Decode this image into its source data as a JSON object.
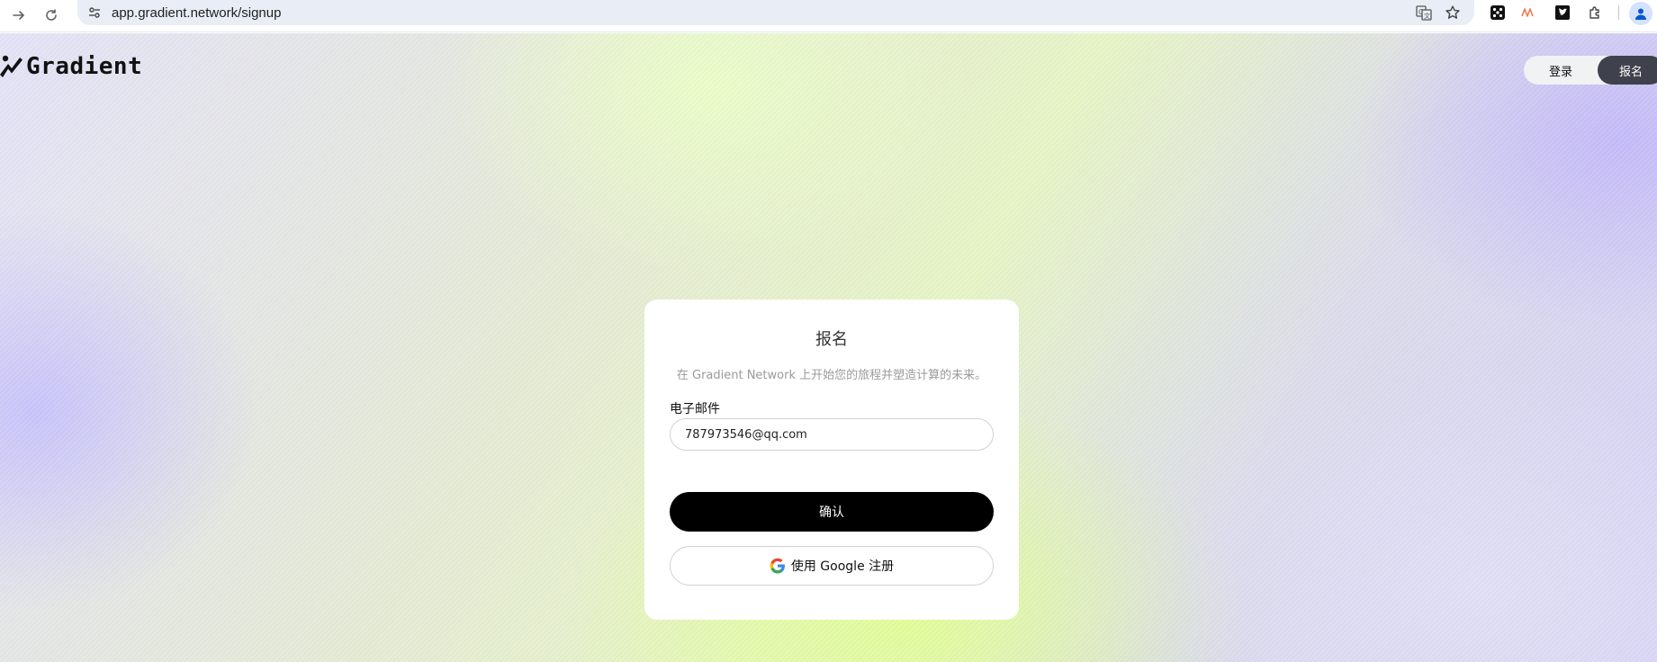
{
  "browser": {
    "url": "app.gradient.network/signup",
    "icons": [
      "arrow-right-icon",
      "reload-icon",
      "site-info-icon",
      "translate-icon",
      "star-icon",
      "extension-dice-icon",
      "extension-n-icon",
      "extension-twitter-icon",
      "extensions-puzzle-icon",
      "profile-icon"
    ]
  },
  "header": {
    "logo_text": "Gradient",
    "login_label": "登录",
    "signup_label": "报名"
  },
  "card": {
    "title": "报名",
    "subtitle": "在 Gradient Network 上开始您的旅程并塑造计算的未来。",
    "email_label": "电子邮件",
    "email_value": "787973546@qq.com",
    "confirm_label": "确认",
    "google_label": "使用 Google 注册"
  },
  "colors": {
    "primary_button": "#000000",
    "active_toggle": "#3f424c",
    "card_bg": "#ffffff"
  }
}
